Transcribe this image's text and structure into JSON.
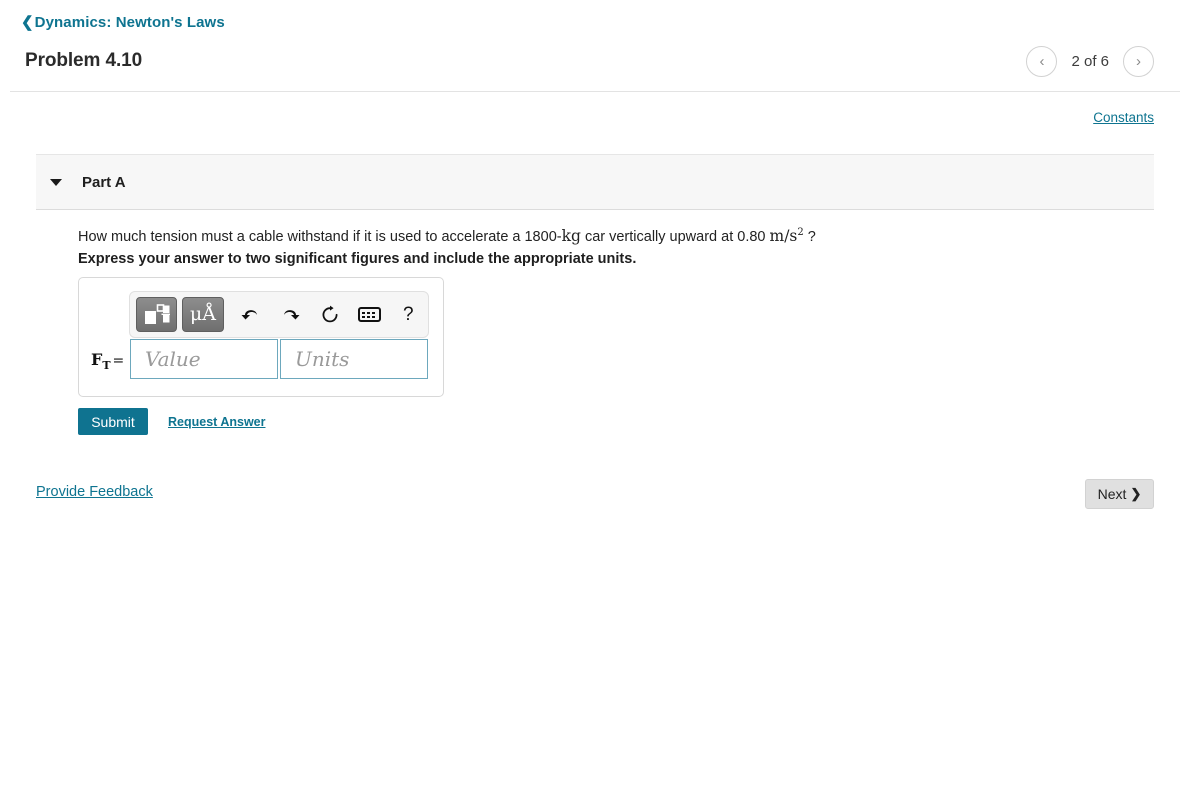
{
  "breadcrumb": {
    "back_icon": "chevron-left-icon",
    "label": "Dynamics: Newton's Laws"
  },
  "header": {
    "problem_title": "Problem 4.10",
    "pager": {
      "prev_icon": "‹",
      "next_icon": "›",
      "label": "2 of 6",
      "current": 2,
      "total": 6
    },
    "constants_link": "Constants"
  },
  "part": {
    "label": "Part A",
    "expanded": true,
    "caret_icon": "caret-down-icon",
    "question": {
      "text_before": "How much tension must a cable withstand if it is used to accelerate a 1800-",
      "unit_mass": "kg",
      "text_middle": " car vertically upward at 0.80 ",
      "unit_accel_base": "m/s",
      "unit_accel_exp": "2",
      "text_after": " ?"
    },
    "instruction": "Express your answer to two significant figures and include the appropriate units."
  },
  "answer": {
    "toolbar": {
      "template_button": {
        "icon": "math-template-icon",
        "title": "Math templates"
      },
      "units_button": {
        "icon": "mu-angstrom-icon",
        "label": "μÅ",
        "title": "Units"
      },
      "undo_button": {
        "icon": "undo-icon",
        "glyph": "↶"
      },
      "redo_button": {
        "icon": "redo-icon",
        "glyph": "↷"
      },
      "reset_button": {
        "icon": "reset-icon",
        "glyph": "↺"
      },
      "keyboard_button": {
        "icon": "keyboard-icon"
      },
      "help_button": {
        "icon": "question-mark-icon",
        "glyph": "?"
      }
    },
    "variable_label": "F",
    "variable_subscript": "T",
    "equals": "=",
    "value_field": {
      "value": "",
      "placeholder": "Value"
    },
    "units_field": {
      "value": "",
      "placeholder": "Units"
    },
    "submit_label": "Submit",
    "request_answer_label": "Request Answer"
  },
  "footer": {
    "provide_feedback": "Provide Feedback",
    "next_label": "Next",
    "next_icon": "❯"
  },
  "colors": {
    "accent_teal": "#0e7490",
    "submit_teal": "#0f7390",
    "panel_gray": "#f7f7f7",
    "field_border": "#6da8bd",
    "next_gray": "#e0e0e0"
  }
}
